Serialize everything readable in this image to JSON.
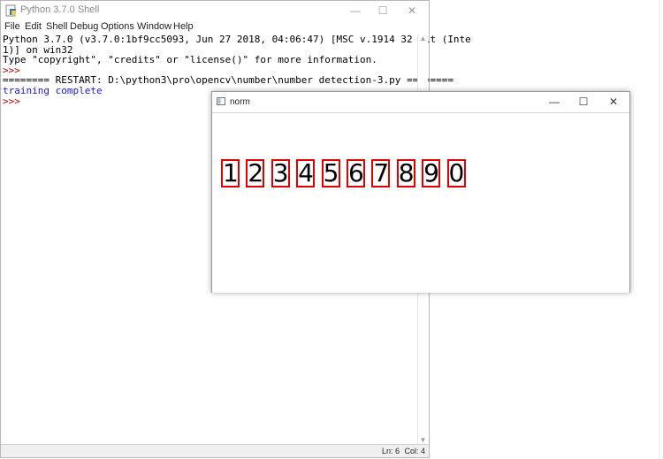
{
  "shell": {
    "title": "Python 3.7.0 Shell",
    "menu": [
      "File",
      "Edit",
      "Shell",
      "Debug",
      "Options",
      "Window",
      "Help"
    ],
    "lines": [
      {
        "text": "Python 3.7.0 (v3.7.0:1bf9cc5093, Jun 27 2018, 04:06:47) [MSC v.1914 32 bit (Inte",
        "kind": "normal"
      },
      {
        "text": "1)] on win32",
        "kind": "normal"
      },
      {
        "text": "Type \"copyright\", \"credits\" or \"license()\" for more information.",
        "kind": "normal"
      },
      {
        "text": ">>> ",
        "kind": "prompt"
      },
      {
        "text": "======== RESTART: D:\\python3\\pro\\opencv\\number\\number detection-3.py ========",
        "kind": "normal"
      },
      {
        "text": "training complete",
        "kind": "stdout"
      },
      {
        "text": ">>> ",
        "kind": "prompt"
      }
    ],
    "status": {
      "ln": "Ln: 6",
      "col": "Col: 4"
    }
  },
  "norm": {
    "title": "norm",
    "digits": [
      "1",
      "2",
      "3",
      "4",
      "5",
      "6",
      "7",
      "8",
      "9",
      "0"
    ]
  },
  "colors": {
    "box": "#e30000",
    "prompt": "#c00000",
    "stdout": "#1a1ad0"
  },
  "icons": {
    "minimize": "minimize-icon",
    "maximize": "maximize-icon",
    "close": "close-icon"
  }
}
